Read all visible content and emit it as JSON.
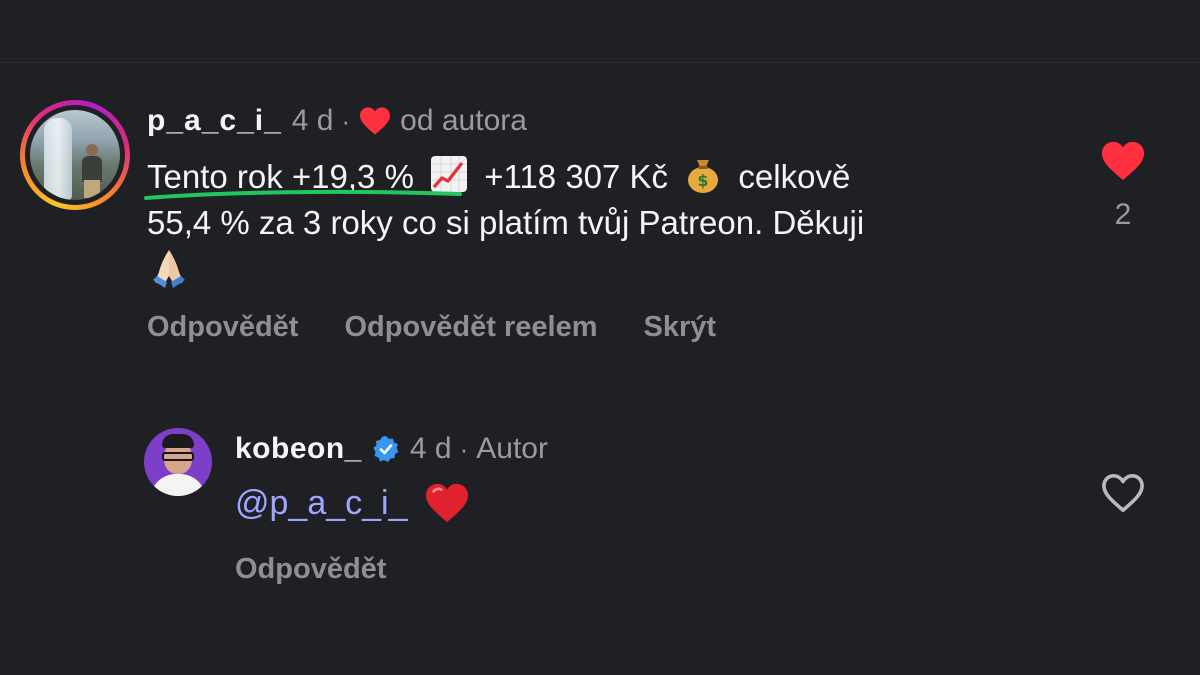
{
  "comments": [
    {
      "username": "p_a_c_i_",
      "time": "4 d",
      "separator": "·",
      "liked_by_author_label": "od autora",
      "text_highlight": "Tento rok +19,3 %",
      "text_part2": "+118 307 Kč",
      "text_part3": "celkově",
      "text_line2": "55,4 % za 3 roky co si platím tvůj Patreon. Děkuji",
      "emojis": [
        "chart-increasing-emoji",
        "money-bag-emoji",
        "folded-hands-emoji"
      ],
      "actions": [
        "Odpovědět",
        "Odpovědět reelem",
        "Skrýt"
      ],
      "like_count": "2",
      "liked": true
    },
    {
      "username": "kobeon_",
      "verified": true,
      "time": "4 d",
      "separator": "·",
      "role": "Autor",
      "mention": "@p_a_c_i_",
      "emoji": "red-heart-emoji",
      "actions": [
        "Odpovědět"
      ],
      "liked": false
    }
  ],
  "colors": {
    "background": "#1f2024",
    "like_red": "#ff3040",
    "mention_blue": "#9fa6ff",
    "highlight_green": "#22c55e",
    "secondary_text": "#9a9ba0"
  }
}
